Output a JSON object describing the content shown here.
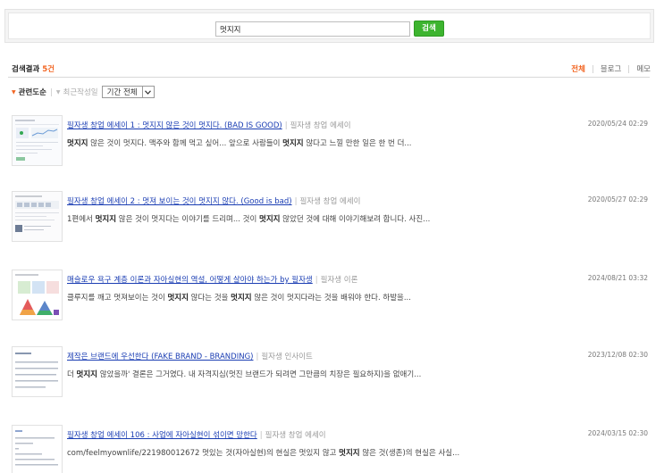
{
  "search": {
    "query": "멋지지",
    "button_label": "검색",
    "button_color": "#3db42f"
  },
  "results_header": {
    "label": "검색결과",
    "count": "5건",
    "accent_color": "#f26522"
  },
  "filter_tabs": [
    {
      "label": "전체",
      "active": true
    },
    {
      "label": "블로그",
      "active": false
    },
    {
      "label": "메모",
      "active": false
    }
  ],
  "sort": {
    "relevance_label": "관련도순",
    "recent_label": "최근작성일",
    "period_value": "기간 전체"
  },
  "results": [
    {
      "title": "필자생 창업 에세이 1 : 멋지지 않은 것이 멋지다. (BAD IS GOOD)",
      "blog": "필자생 창업 에세이",
      "date": "2020/05/24 02:29",
      "snippet": [
        {
          "t": "멋지지",
          "b": true
        },
        {
          "t": " 않은 것이 멋지다. 맥주와 함께 먹고 싶어... 앞으로 사람들이 ",
          "b": false
        },
        {
          "t": "멋지지",
          "b": true
        },
        {
          "t": " 않다고 느낄 만한 일은 한 번 더...",
          "b": false
        }
      ]
    },
    {
      "title": "필자생 창업 에세이 2 : 멋져 보이는 것이 멋지지 않다. (Good is bad)",
      "blog": "필자생 창업 에세이",
      "date": "2020/05/27 02:29",
      "snippet": [
        {
          "t": "1편에서 ",
          "b": false
        },
        {
          "t": "멋지지",
          "b": true
        },
        {
          "t": " 않은 것이 멋지다는 이야기를 드리며... 것이 ",
          "b": false
        },
        {
          "t": "멋지지",
          "b": true
        },
        {
          "t": " 않았던 것에 대해 이야기해보려 합니다. 사진...",
          "b": false
        }
      ]
    },
    {
      "title": "매슬로우 욕구 계층 이론과 자아실현의 역설, 어떻게 살아야 하는가 by 필자생",
      "blog": "필자생 이론",
      "date": "2024/08/21 03:32",
      "snippet": [
        {
          "t": "클루지를 깨고 멋져보이는 것이 ",
          "b": false
        },
        {
          "t": "멋지지",
          "b": true
        },
        {
          "t": " 않다는 것을 ",
          "b": false
        },
        {
          "t": "멋지지",
          "b": true
        },
        {
          "t": " 않은 것이 멋지다라는 것을 배워야 한다. 하발을...",
          "b": false
        }
      ]
    },
    {
      "title": "제작은 브랜드에 우선한다 (FAKE BRAND - BRANDING)",
      "blog": "필자생 인사이트",
      "date": "2023/12/08 02:30",
      "snippet": [
        {
          "t": "더 ",
          "b": false
        },
        {
          "t": "멋지지",
          "b": true
        },
        {
          "t": " 않았을까' 결론은 그거였다. 내 자격지심(멋진 브랜드가 되려면 그만큼의 치장은 필요하지)을 없애기...",
          "b": false
        }
      ]
    },
    {
      "title": "필자생 창업 에세이 106 : 사업에 자아실현이 섞이면 망한다",
      "blog": "필자생 창업 에세이",
      "date": "2024/03/15 02:30",
      "snippet": [
        {
          "t": "com/feelmyownlife/221980012672 멋있는 것(자아실현)의 현실은 멋있지 않고 ",
          "b": false
        },
        {
          "t": "멋지지",
          "b": true
        },
        {
          "t": " 않은 것(생존)의 현실은 사실...",
          "b": false
        }
      ]
    }
  ]
}
